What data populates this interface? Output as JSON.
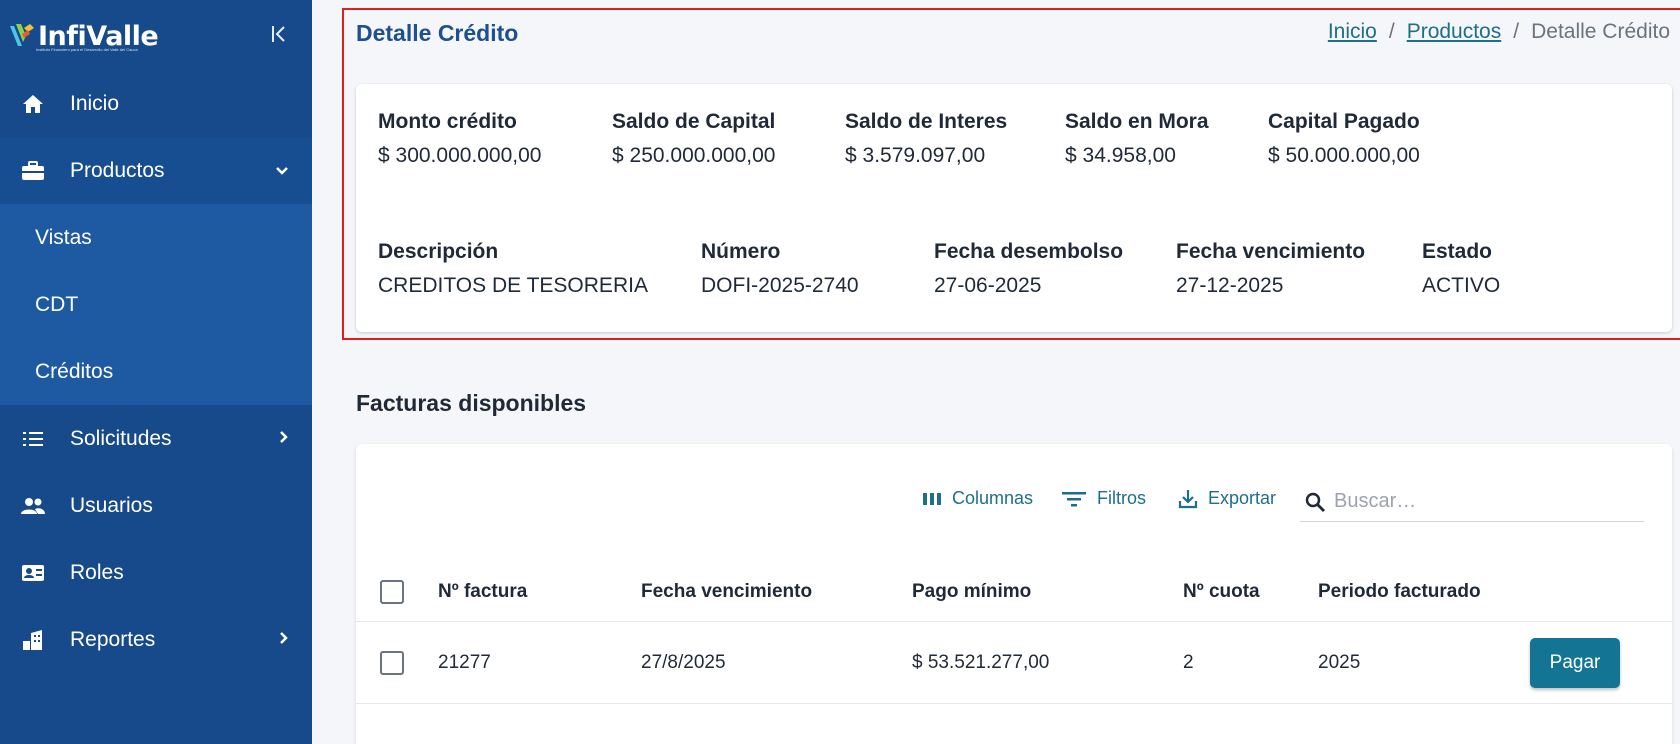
{
  "brand": {
    "name": "InfiValle",
    "tagline": "Instituto Financiero para el Desarrollo del Valle del Cauca"
  },
  "sidebar": {
    "items": [
      {
        "label": "Inicio",
        "icon": "home-icon"
      },
      {
        "label": "Productos",
        "icon": "briefcase-icon",
        "chevron": "˅"
      },
      {
        "label": "Solicitudes",
        "icon": "list-icon",
        "chevron": "›"
      },
      {
        "label": "Usuarios",
        "icon": "users-icon"
      },
      {
        "label": "Roles",
        "icon": "id-card-icon"
      },
      {
        "label": "Reportes",
        "icon": "building-icon",
        "chevron": "›"
      }
    ],
    "subitems": [
      "Vistas",
      "CDT",
      "Créditos"
    ]
  },
  "header": {
    "title": "Detalle Crédito",
    "breadcrumb": [
      "Inicio",
      "Productos",
      "Detalle Crédito"
    ],
    "separator": "/"
  },
  "credit": {
    "row1": [
      {
        "label": "Monto crédito",
        "value": "$ 300.000.000,00"
      },
      {
        "label": "Saldo de Capital",
        "value": "$ 250.000.000,00"
      },
      {
        "label": "Saldo de Interes",
        "value": "$ 3.579.097,00"
      },
      {
        "label": "Saldo en Mora",
        "value": "$ 34.958,00"
      },
      {
        "label": "Capital Pagado",
        "value": "$ 50.000.000,00"
      }
    ],
    "row2": [
      {
        "label": "Descripción",
        "value": "CREDITOS DE TESORERIA"
      },
      {
        "label": "Número",
        "value": "DOFI-2025-2740"
      },
      {
        "label": "Fecha desembolso",
        "value": "27-06-2025"
      },
      {
        "label": "Fecha vencimiento",
        "value": "27-12-2025"
      },
      {
        "label": "Estado",
        "value": "ACTIVO"
      }
    ]
  },
  "invoices": {
    "title": "Facturas disponibles",
    "toolbar": {
      "columns": "Columnas",
      "filters": "Filtros",
      "export": "Exportar",
      "search_placeholder": "Buscar…"
    },
    "columns": [
      "Nº factura",
      "Fecha vencimiento",
      "Pago mínimo",
      "Nº cuota",
      "Periodo facturado"
    ],
    "rows": [
      {
        "factura": "21277",
        "vencimiento": "27/8/2025",
        "pago_minimo": "$ 53.521.277,00",
        "cuota": "2",
        "periodo": "2025",
        "action": "Pagar"
      }
    ]
  },
  "colors": {
    "sidebar": "#164a8a",
    "accent": "#137494",
    "highlight_border": "#e11d1d"
  }
}
